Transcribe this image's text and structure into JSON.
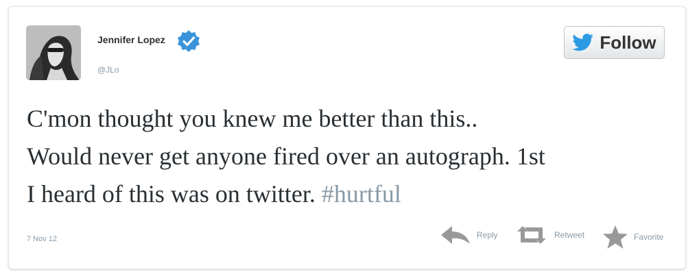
{
  "user": {
    "name": "Jennifer Lopez",
    "handle": "@JLo",
    "verified_icon": "verified-badge-icon",
    "avatar": "profile-photo"
  },
  "follow": {
    "label": "Follow",
    "icon": "twitter-bird-icon"
  },
  "tweet": {
    "line1": "C'mon thought you knew me better than this..",
    "line2": "Would never get anyone fired over an autograph. 1st",
    "line3_prefix": "I heard of this was on twitter. ",
    "hashtag": "#hurtful"
  },
  "footer": {
    "date": "7 Nov 12",
    "actions": [
      {
        "label": "Reply",
        "icon": "reply-icon"
      },
      {
        "label": "Retweet",
        "icon": "retweet-icon"
      },
      {
        "label": "Favorite",
        "icon": "star-icon"
      }
    ]
  },
  "colors": {
    "text": "#292f33",
    "muted": "#8899a6",
    "verified_blue": "#3b94d9",
    "bird_blue": "#2b9ae3",
    "action_gray": "#999999"
  }
}
